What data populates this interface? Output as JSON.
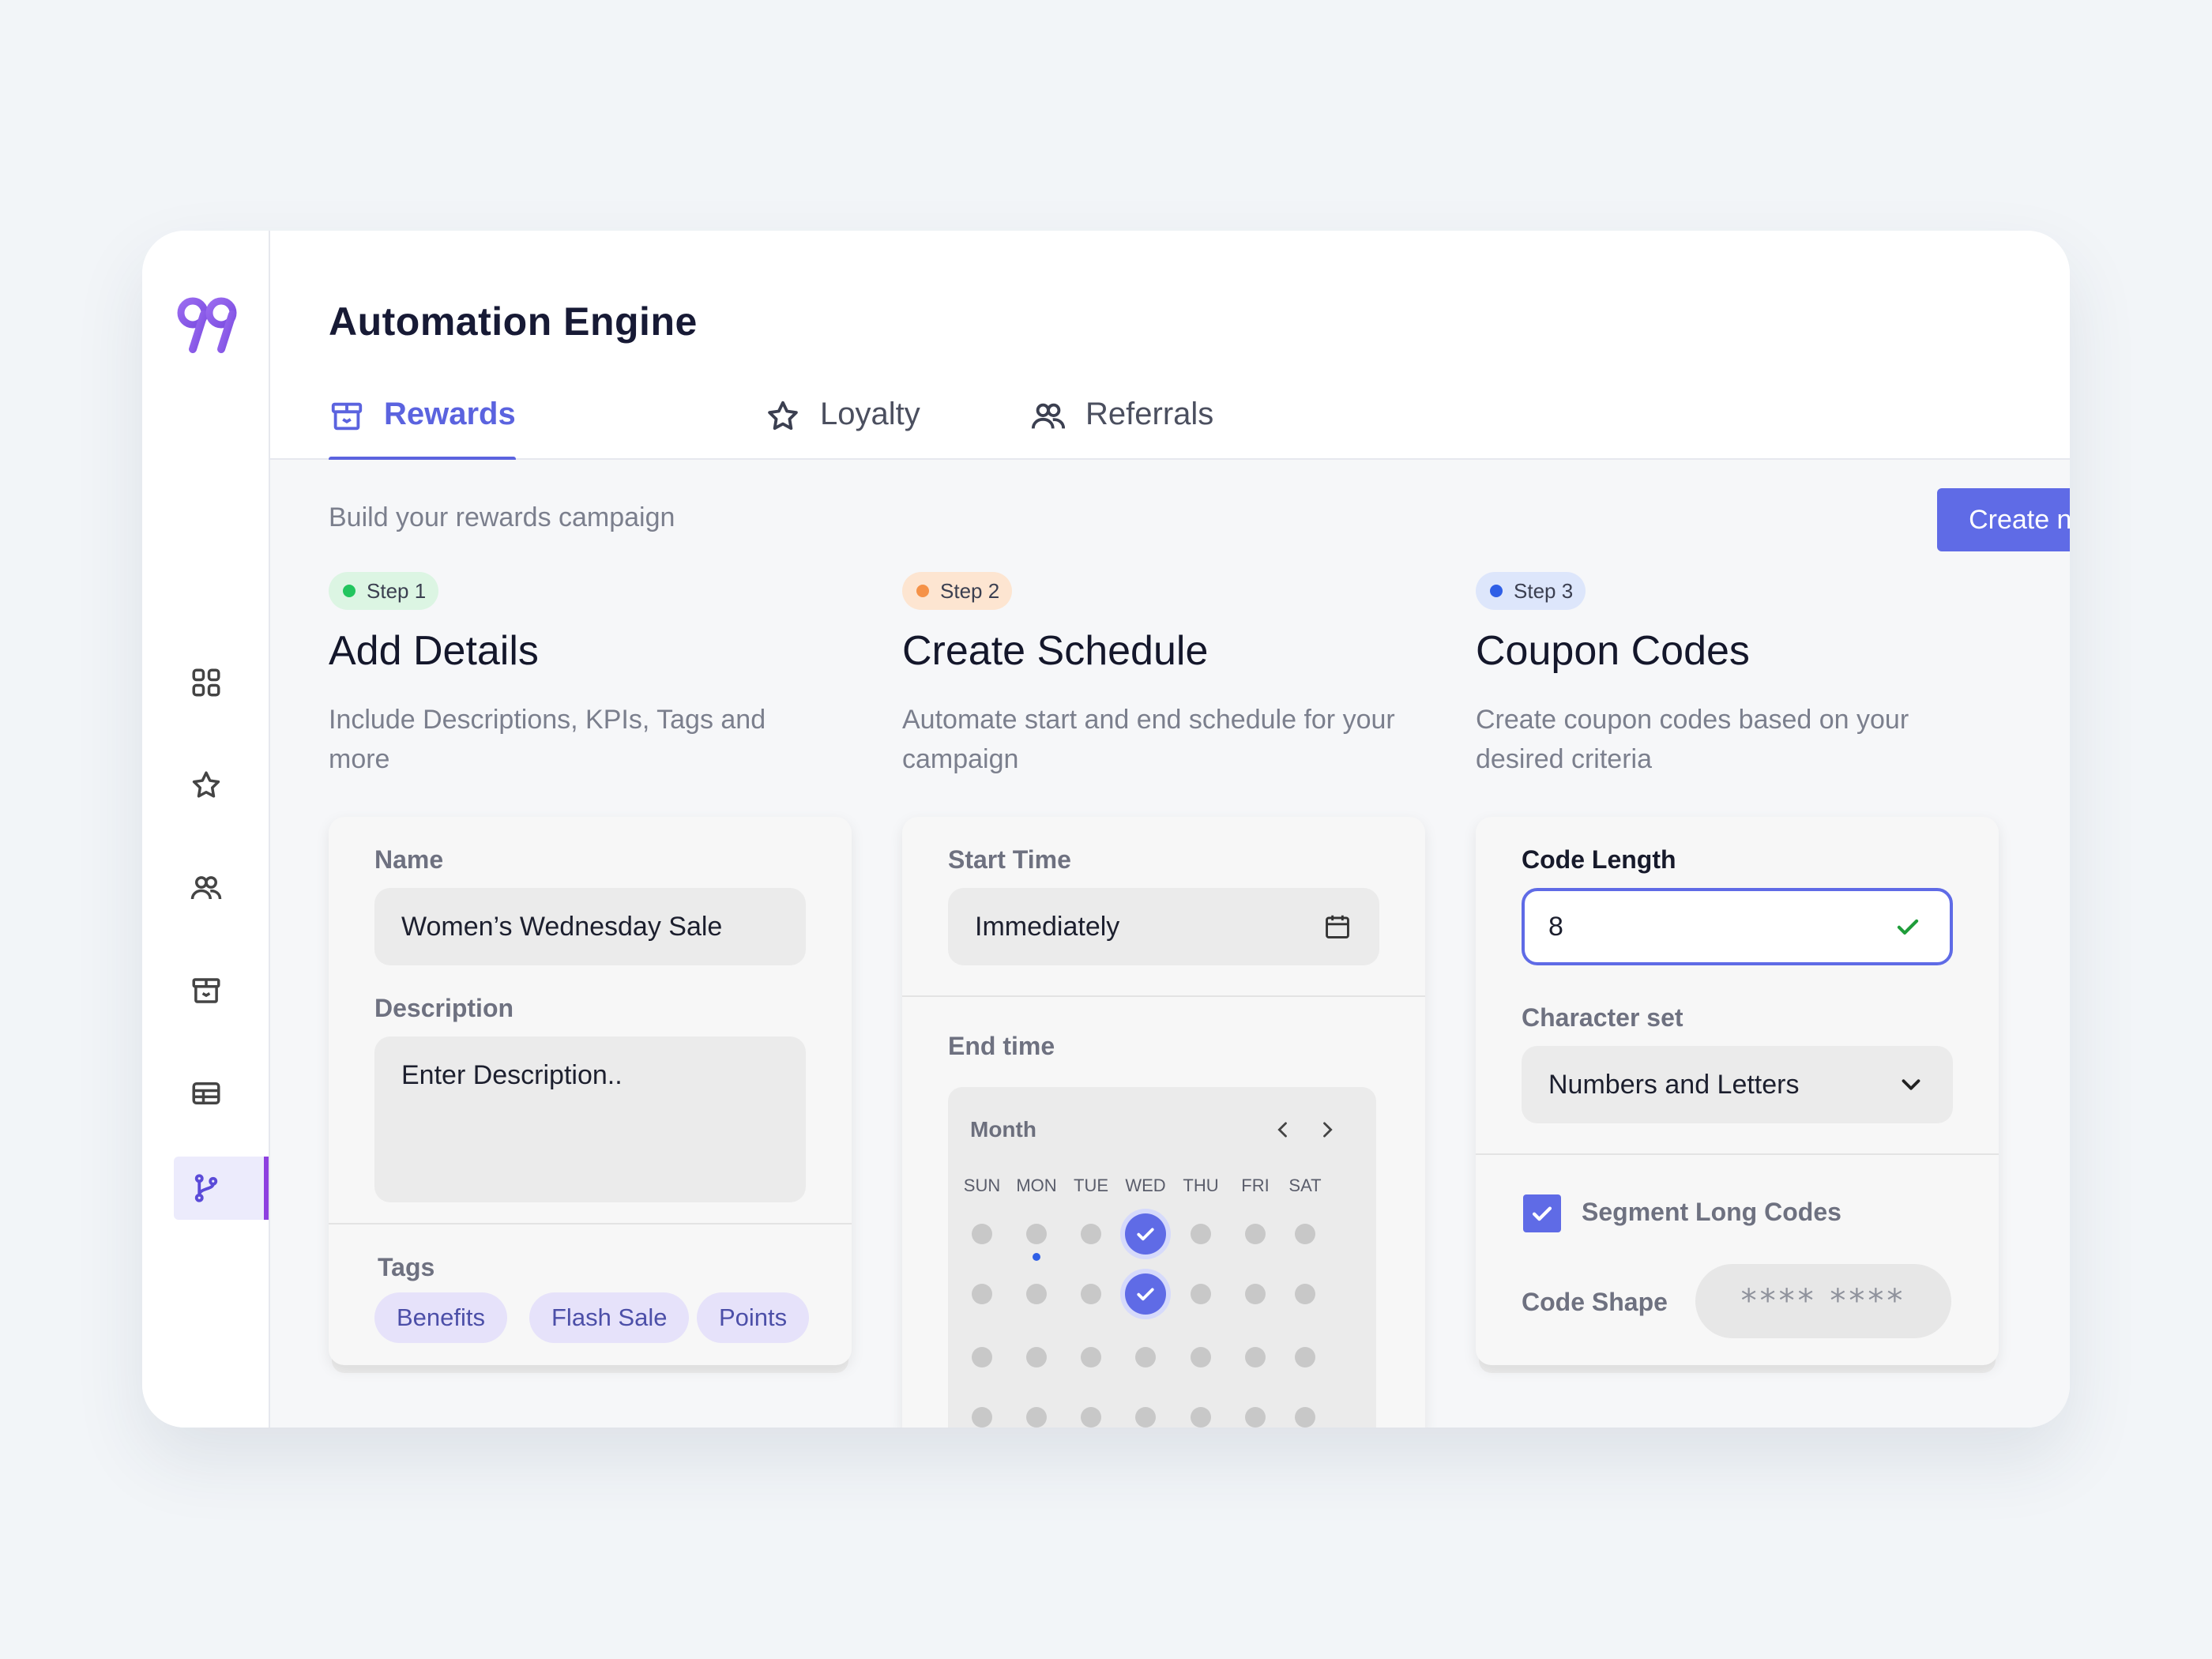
{
  "app": {
    "title": "Automation Engine",
    "logo_alt": "99"
  },
  "sidebar": {
    "items": [
      {
        "icon": "grid-icon"
      },
      {
        "icon": "star-icon"
      },
      {
        "icon": "users-icon"
      },
      {
        "icon": "gift-icon"
      },
      {
        "icon": "table-icon"
      },
      {
        "icon": "branch-icon",
        "active": true
      }
    ]
  },
  "tabs": [
    {
      "label": "Rewards",
      "icon": "gift-icon",
      "active": true
    },
    {
      "label": "Loyalty",
      "icon": "star-icon"
    },
    {
      "label": "Referrals",
      "icon": "users-icon"
    }
  ],
  "content": {
    "subtitle": "Build your rewards campaign",
    "create_button": "Create new"
  },
  "steps": [
    {
      "badge": "Step 1",
      "dot_color": "#22c55e",
      "badge_bg": "#dcf5e3",
      "title": "Add Details",
      "description": "Include Descriptions, KPIs, Tags and more",
      "name_label": "Name",
      "name_value": "Women’s Wednesday Sale",
      "description_label": "Description",
      "description_placeholder": "Enter Description..",
      "tags_label": "Tags",
      "tags": [
        "Benefits",
        "Flash Sale",
        "Points"
      ]
    },
    {
      "badge": "Step 2",
      "dot_color": "#f59248",
      "badge_bg": "#fde5d1",
      "title": "Create Schedule",
      "description": "Automate start and end schedule for your campaign",
      "start_label": "Start Time",
      "start_value": "Immediately",
      "end_label": "End time",
      "calendar": {
        "month_label": "Month",
        "weekdays": [
          "SUN",
          "MON",
          "TUE",
          "WED",
          "THU",
          "FRI",
          "SAT"
        ]
      }
    },
    {
      "badge": "Step 3",
      "dot_color": "#2f5fe6",
      "badge_bg": "#dde6fb",
      "title": "Coupon Codes",
      "description": "Create coupon codes based on your desired criteria",
      "code_length_label": "Code Length",
      "code_length_value": "8",
      "charset_label": "Character set",
      "charset_value": "Numbers and Letters",
      "segment_label": "Segment Long Codes",
      "segment_checked": true,
      "shape_label": "Code Shape",
      "shape_value": "**** ****"
    }
  ],
  "colors": {
    "accent": "#5f6be6",
    "sidebar_active_bar": "#8d3fe0"
  }
}
